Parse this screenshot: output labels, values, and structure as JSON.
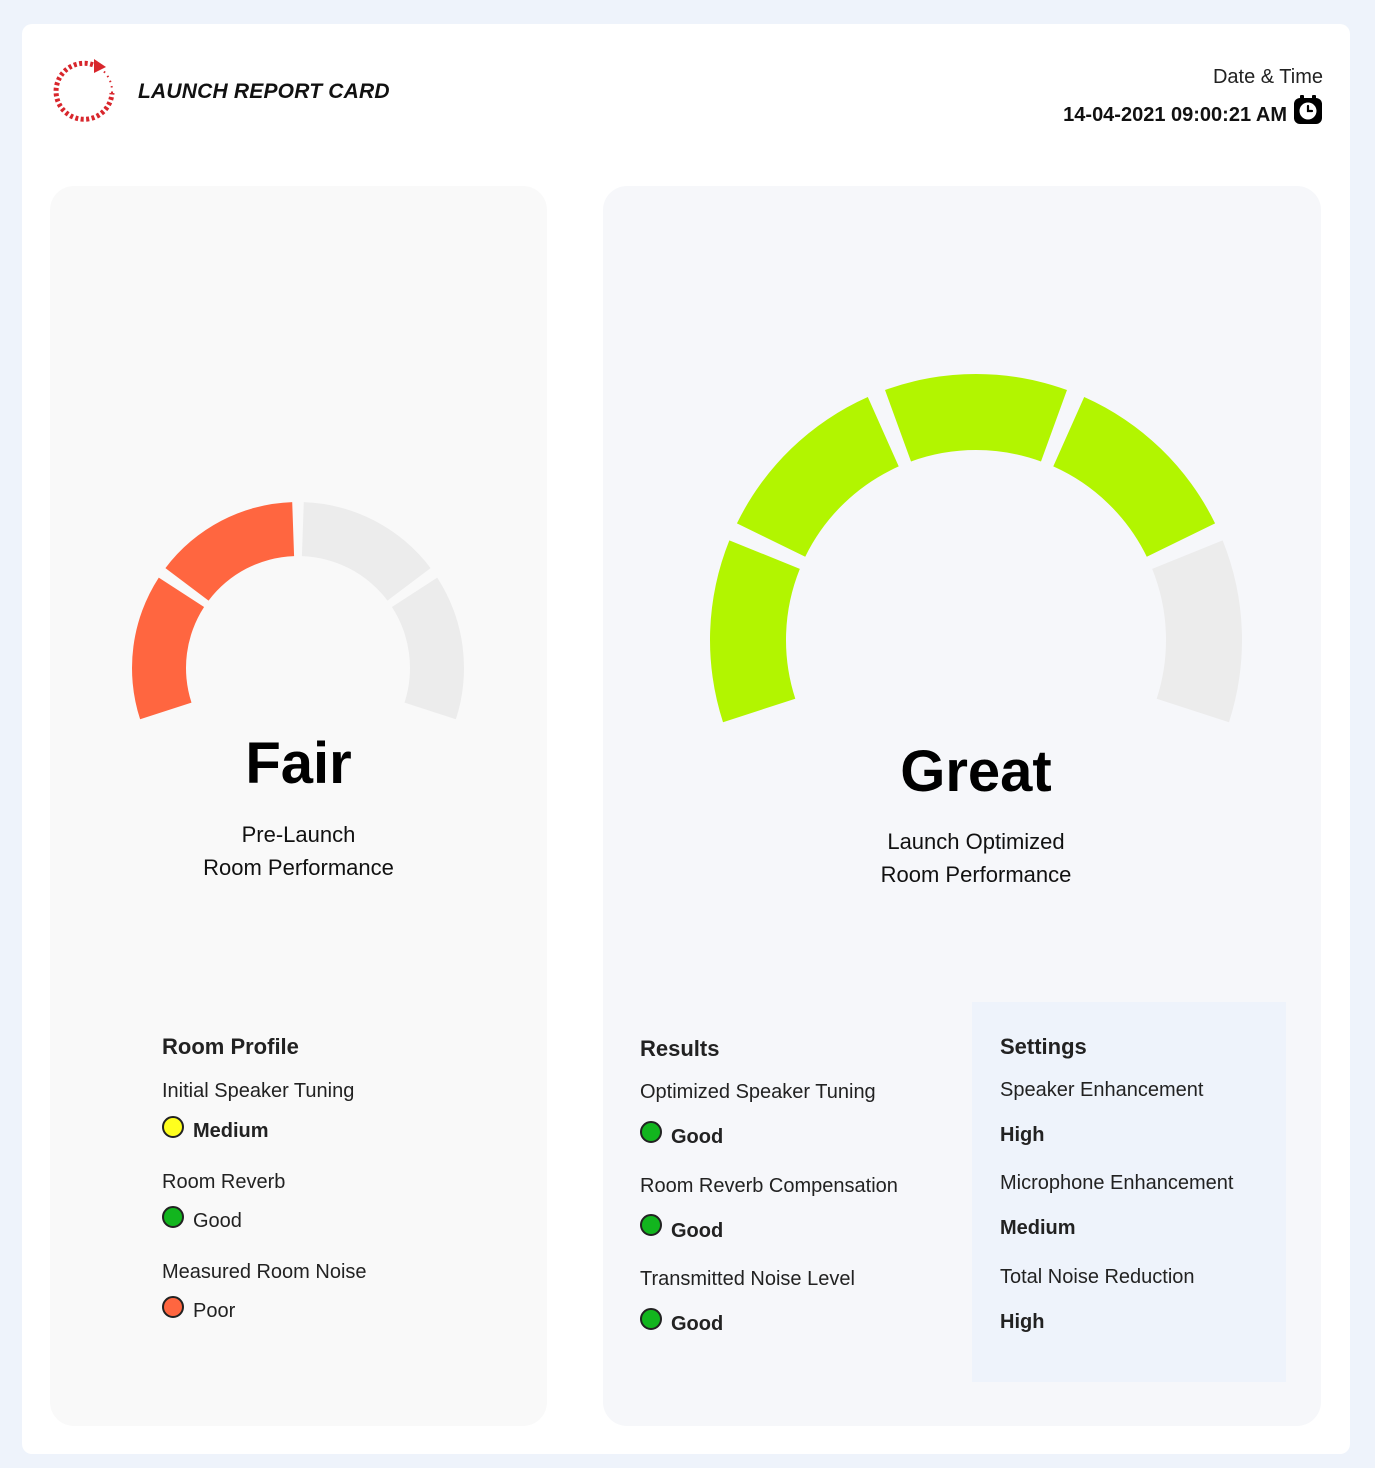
{
  "header": {
    "title": "LAUNCH REPORT CARD",
    "date_label": "Date & Time",
    "date_value": "14-04-2021 09:00:21 AM",
    "logo_icon": "circular-arrow-logo-icon",
    "clock_icon": "clock-icon"
  },
  "pre_launch": {
    "rating": "Fair",
    "caption_line1": "Pre-Launch",
    "caption_line2": "Room Performance",
    "gauge_segments_total": 4,
    "gauge_segments_filled": 2,
    "gauge_fill_color": "#ff6640",
    "gauge_empty_color": "#ececec",
    "room_profile": {
      "title": "Room Profile",
      "items": [
        {
          "label": "Initial Speaker Tuning",
          "value": "Medium",
          "status_color": "#ffff1e"
        },
        {
          "label": "Room Reverb",
          "value": "Good",
          "status_color": "#12b51e"
        },
        {
          "label": "Measured Room Noise",
          "value": "Poor",
          "status_color": "#ff6640"
        }
      ]
    }
  },
  "launch_optimized": {
    "rating": "Great",
    "caption_line1": "Launch Optimized",
    "caption_line2": "Room Performance",
    "gauge_segments_total": 5,
    "gauge_segments_filled": 4,
    "gauge_fill_color": "#b2f500",
    "gauge_empty_color": "#ececec",
    "results": {
      "title": "Results",
      "items": [
        {
          "label": "Optimized Speaker Tuning",
          "value": "Good",
          "status_color": "#12b51e"
        },
        {
          "label": "Room Reverb Compensation",
          "value": "Good",
          "status_color": "#12b51e"
        },
        {
          "label": "Transmitted Noise Level",
          "value": "Good",
          "status_color": "#12b51e"
        }
      ]
    },
    "settings": {
      "title": "Settings",
      "items": [
        {
          "label": "Speaker Enhancement",
          "value": "High"
        },
        {
          "label": "Microphone Enhancement",
          "value": "Medium"
        },
        {
          "label": "Total Noise Reduction",
          "value": "High"
        }
      ]
    }
  }
}
